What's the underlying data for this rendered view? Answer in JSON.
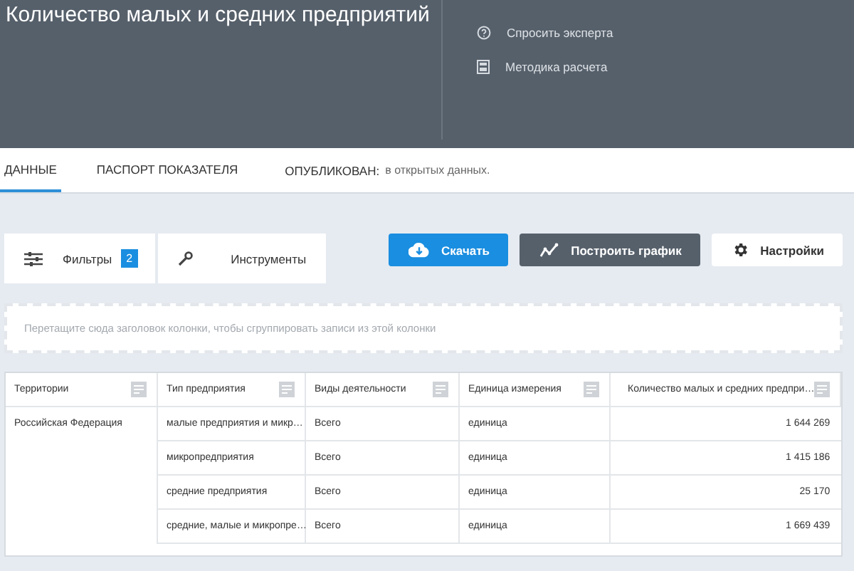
{
  "header": {
    "title": "Количество малых и средних предприятий",
    "links": [
      {
        "label": "Спросить эксперта",
        "kind": "help"
      },
      {
        "label": "Методика расчета",
        "kind": "doc"
      }
    ]
  },
  "tabs": [
    {
      "label": "ДАННЫЕ",
      "selected": true
    },
    {
      "label": "ПАСПОРТ ПОКАЗАТЕЛЯ",
      "selected": false
    }
  ],
  "published": {
    "label": "ОПУБЛИКОВАН:",
    "value": "в открытых данных."
  },
  "panel_tabs": [
    {
      "label": "Фильтры",
      "badge": "2",
      "kind": "filters"
    },
    {
      "label": "Инструменты",
      "kind": "tools"
    }
  ],
  "actions": [
    {
      "label": "Скачать",
      "kind": "download"
    },
    {
      "label": "Построить график",
      "kind": "chart"
    },
    {
      "label": "Настройки",
      "kind": "settings"
    }
  ],
  "group_zone": {
    "placeholder": "Перетащите сюда заголовок колонки, чтобы сгруппировать записи из этой колонки"
  },
  "table": {
    "columns": [
      {
        "label": "Территории"
      },
      {
        "label": "Тип предприятия"
      },
      {
        "label": "Виды деятельности"
      },
      {
        "label": "Единица измерения"
      },
      {
        "label": "Количество малых и средних предпри…"
      }
    ],
    "territory": "Российская Федерация",
    "rows": [
      {
        "type": "малые предприятия и микр…",
        "activity": "Всего",
        "unit": "единица",
        "value": "1 644 269"
      },
      {
        "type": "микропредприятия",
        "activity": "Всего",
        "unit": "единица",
        "value": "1 415 186"
      },
      {
        "type": "средние предприятия",
        "activity": "Всего",
        "unit": "единица",
        "value": "25 170"
      },
      {
        "type": "средние, малые и микропре…",
        "activity": "Всего",
        "unit": "единица",
        "value": "1 669 439"
      }
    ]
  }
}
